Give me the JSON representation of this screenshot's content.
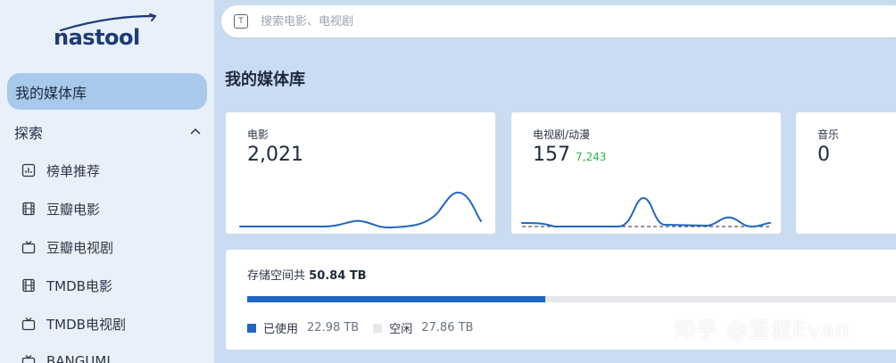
{
  "app": {
    "logo": "nastool"
  },
  "sidebar": {
    "active": "我的媒体库",
    "group": "探索",
    "items": [
      {
        "label": "榜单推荐",
        "icon": "chart-icon"
      },
      {
        "label": "豆瓣电影",
        "icon": "film-icon"
      },
      {
        "label": "豆瓣电视剧",
        "icon": "tv-icon"
      },
      {
        "label": "TMDB电影",
        "icon": "film-icon"
      },
      {
        "label": "TMDB电视剧",
        "icon": "tv-icon"
      },
      {
        "label": "BANGUMI",
        "icon": "tv-icon"
      }
    ]
  },
  "search": {
    "placeholder": "搜索电影、电视剧"
  },
  "page": {
    "title": "我的媒体库"
  },
  "cards": {
    "movies": {
      "label": "电影",
      "value": "2,021"
    },
    "tv": {
      "label": "电视剧/动漫",
      "value": "157",
      "sub": "7,243"
    },
    "music": {
      "label": "音乐",
      "value": "0"
    }
  },
  "storage": {
    "title_prefix": "存储空间共",
    "total": "50.84 TB",
    "used_fraction": 0.452,
    "used_label": "已使用",
    "used_value": "22.98 TB",
    "free_label": "空闲",
    "free_value": "27.86 TB"
  },
  "watermark": "知乎 @坚叔Evan",
  "colors": {
    "accent": "#2166c0",
    "active_nav": "#a9c9ec",
    "positive": "#2fb344",
    "background": "#c9dcf1"
  }
}
